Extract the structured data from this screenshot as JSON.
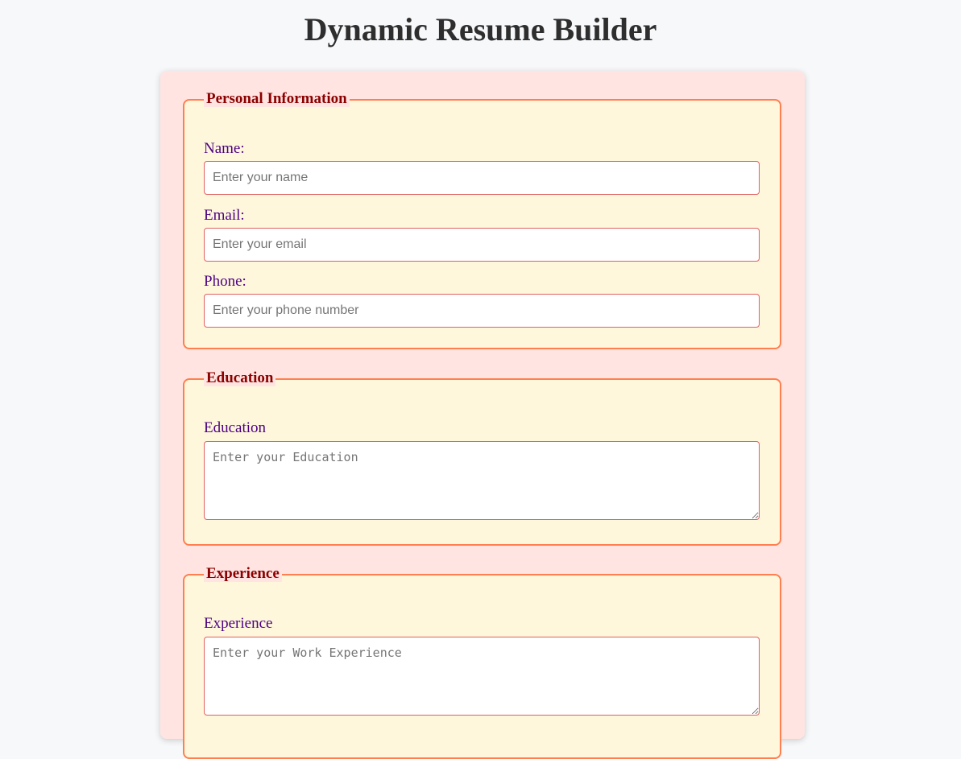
{
  "page": {
    "title": "Dynamic Resume Builder"
  },
  "colors": {
    "page_background": "#f7f8fa",
    "card_background": "#ffe4e1",
    "section_background": "#fff7dc",
    "section_border": "#ff7f50",
    "legend_text": "#8b0000",
    "label_text": "#4b0082",
    "input_border": "#e06060"
  },
  "personal": {
    "legend": "Personal Information",
    "name_label": "Name:",
    "name_placeholder": "Enter your name",
    "name_value": "",
    "email_label": "Email:",
    "email_placeholder": "Enter your email",
    "email_value": "",
    "phone_label": "Phone:",
    "phone_placeholder": "Enter your phone number",
    "phone_value": ""
  },
  "education": {
    "legend": "Education",
    "label": "Education",
    "placeholder": "Enter your Education",
    "value": ""
  },
  "experience": {
    "legend": "Experience",
    "label": "Experience",
    "placeholder": "Enter your Work Experience",
    "value": ""
  }
}
